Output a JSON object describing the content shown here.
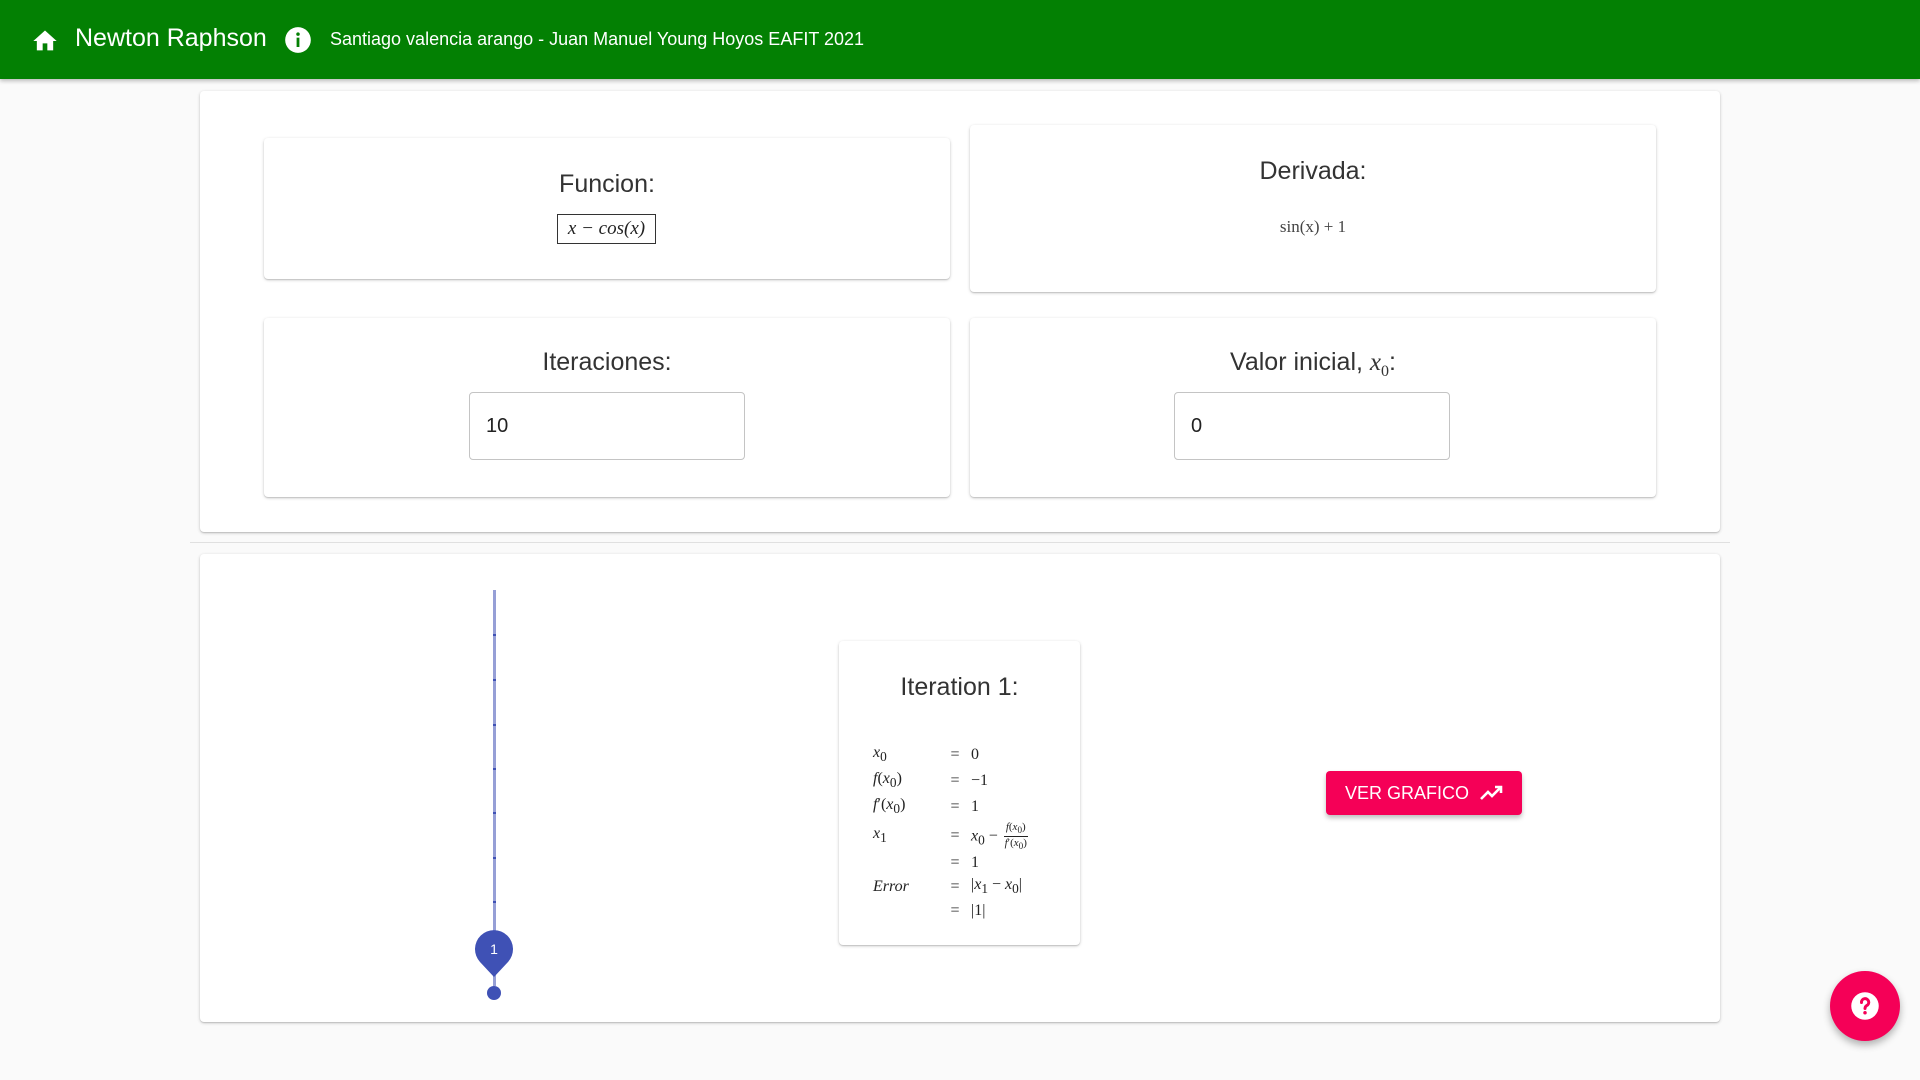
{
  "appbar": {
    "title": "Newton Raphson",
    "authors": "Santiago valencia arango - Juan Manuel Young Hoyos EAFIT 2021",
    "home_icon": "home-icon",
    "info_icon": "info-icon",
    "color": "#038003"
  },
  "inputs": {
    "funcion_label": "Funcion:",
    "funcion_value": "x − cos(x)",
    "derivada_label": "Derivada:",
    "derivada_value": "sin(x) + 1",
    "iteraciones_label": "Iteraciones:",
    "iteraciones_value": "10",
    "valor_inicial_label": "Valor inicial, ",
    "valor_inicial_symbol": "x0",
    "valor_inicial_value": "0"
  },
  "timeline": {
    "marker_label": "1",
    "color": "#3f51b5"
  },
  "iteration": {
    "title": "Iteration 1:",
    "rows": [
      {
        "lhs": "x0",
        "eq": "=",
        "rhs": "0"
      },
      {
        "lhs": "f(x0)",
        "eq": "=",
        "rhs": "−1"
      },
      {
        "lhs": "f′(x0)",
        "eq": "=",
        "rhs": "1"
      },
      {
        "lhs": "x1",
        "eq": "=",
        "rhs": "x0 −",
        "frac_num": "f(x0)",
        "frac_den": "f′(x0)"
      },
      {
        "lhs": "",
        "eq": "=",
        "rhs": "1"
      },
      {
        "lhs": "Error",
        "eq": "=",
        "rhs": "|x1 − x0|"
      },
      {
        "lhs": "",
        "eq": "=",
        "rhs": "|1|"
      }
    ]
  },
  "actions": {
    "ver_grafico": "VER GRAFICO",
    "chart_icon": "trending-up-icon",
    "help_icon": "help-icon",
    "accent": "#f50057"
  }
}
